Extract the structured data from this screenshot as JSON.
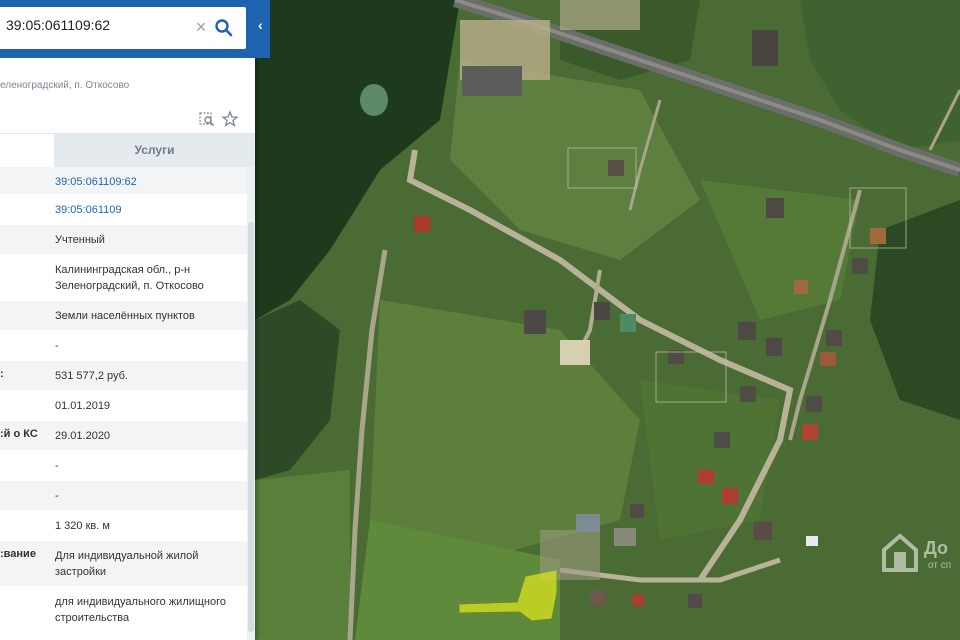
{
  "search": {
    "value": "39:05:061109:62",
    "placeholder": ""
  },
  "card": {
    "address_header": "еленоградский, п. Откосово"
  },
  "tabs": {
    "services_label": "Услуги"
  },
  "rows": [
    {
      "label": "",
      "value": "39:05:061109:62"
    },
    {
      "label": "",
      "value": "39:05:061109"
    },
    {
      "label": "",
      "value": "Учтенный"
    },
    {
      "label": "",
      "value": "Калининградская обл., р-н Зеленоградский, п. Откосово"
    },
    {
      "label": "",
      "value": "Земли населённых пунктов"
    },
    {
      "label": "",
      "value": "-"
    },
    {
      "label": ":",
      "value": "531 577,2 руб."
    },
    {
      "label": "",
      "value": "01.01.2019"
    },
    {
      "label": "й о КС:",
      "value": "29.01.2020"
    },
    {
      "label": "",
      "value": "-"
    },
    {
      "label": "",
      "value": "-"
    },
    {
      "label": "",
      "value": "1 320 кв. м"
    },
    {
      "label": "вание:",
      "value": "Для индивидуальной жилой застройки"
    },
    {
      "label": "",
      "value": "для индивидуального жилищного строительства"
    }
  ],
  "watermark": {
    "line1": "До",
    "line2": "от сп"
  },
  "colors": {
    "brand_blue": "#1f63b0",
    "parcel_highlight": "#d9e21f"
  },
  "icons": {
    "clear": "close-icon",
    "search": "search-icon",
    "collapse": "chevron-left-icon",
    "zoom_to": "zoom-to-icon",
    "favorite": "star-icon"
  }
}
